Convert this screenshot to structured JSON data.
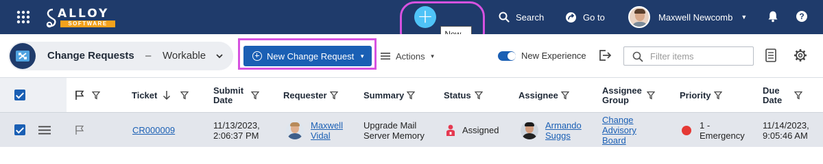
{
  "topbar": {
    "logo_text": "ALLOY",
    "logo_sub": "SOFTWARE",
    "new_button_symbol": "+",
    "new_tooltip": "New...",
    "search_label": "Search",
    "goto_label": "Go to",
    "user_name": "Maxwell Newcomb",
    "help_symbol": "?"
  },
  "toolbar": {
    "view_title": "Change Requests",
    "view_separator": "–",
    "view_name": "Workable",
    "new_request_label": "New Change Request",
    "actions_label": "Actions",
    "new_experience_label": "New Experience",
    "new_experience_on": true,
    "filter_placeholder": "Filter items"
  },
  "grid": {
    "columns": [
      {
        "label": "Ticket"
      },
      {
        "label": "Submit Date"
      },
      {
        "label": "Requester"
      },
      {
        "label": "Summary"
      },
      {
        "label": "Status"
      },
      {
        "label": "Assignee"
      },
      {
        "label": "Assignee Group"
      },
      {
        "label": "Priority"
      },
      {
        "label": "Due Date"
      }
    ],
    "rows": [
      {
        "selected": true,
        "ticket": "CR000009",
        "submit_date_1": "11/13/2023,",
        "submit_date_2": "2:06:37 PM",
        "requester_1": "Maxwell",
        "requester_2": "Vidal",
        "summary_1": "Upgrade Mail",
        "summary_2": "Server Memory",
        "status": "Assigned",
        "assignee_1": "Armando",
        "assignee_2": "Suggs",
        "group_1": "Change",
        "group_2": "Advisory",
        "group_3": "Board",
        "priority_1": "1 -",
        "priority_2": "Emergency",
        "priority_color": "#e53935",
        "due_1": "11/14/2023,",
        "due_2": "9:05:46 AM"
      }
    ]
  },
  "colors": {
    "topbar": "#1f3b6b",
    "accent": "#1a5fb4",
    "highlight": "#d652e0",
    "new_button": "#4fc3f7",
    "logo_orange": "#f4a21c"
  },
  "icons": [
    "apps-grid-icon",
    "search-icon",
    "goto-icon",
    "bell-icon",
    "help-icon",
    "chevron-down-icon",
    "plus-circle-icon",
    "hamburger-icon",
    "export-icon",
    "list-icon",
    "gear-icon",
    "flag-icon",
    "funnel-icon",
    "sort-down-arrow-icon",
    "status-person-icon"
  ]
}
